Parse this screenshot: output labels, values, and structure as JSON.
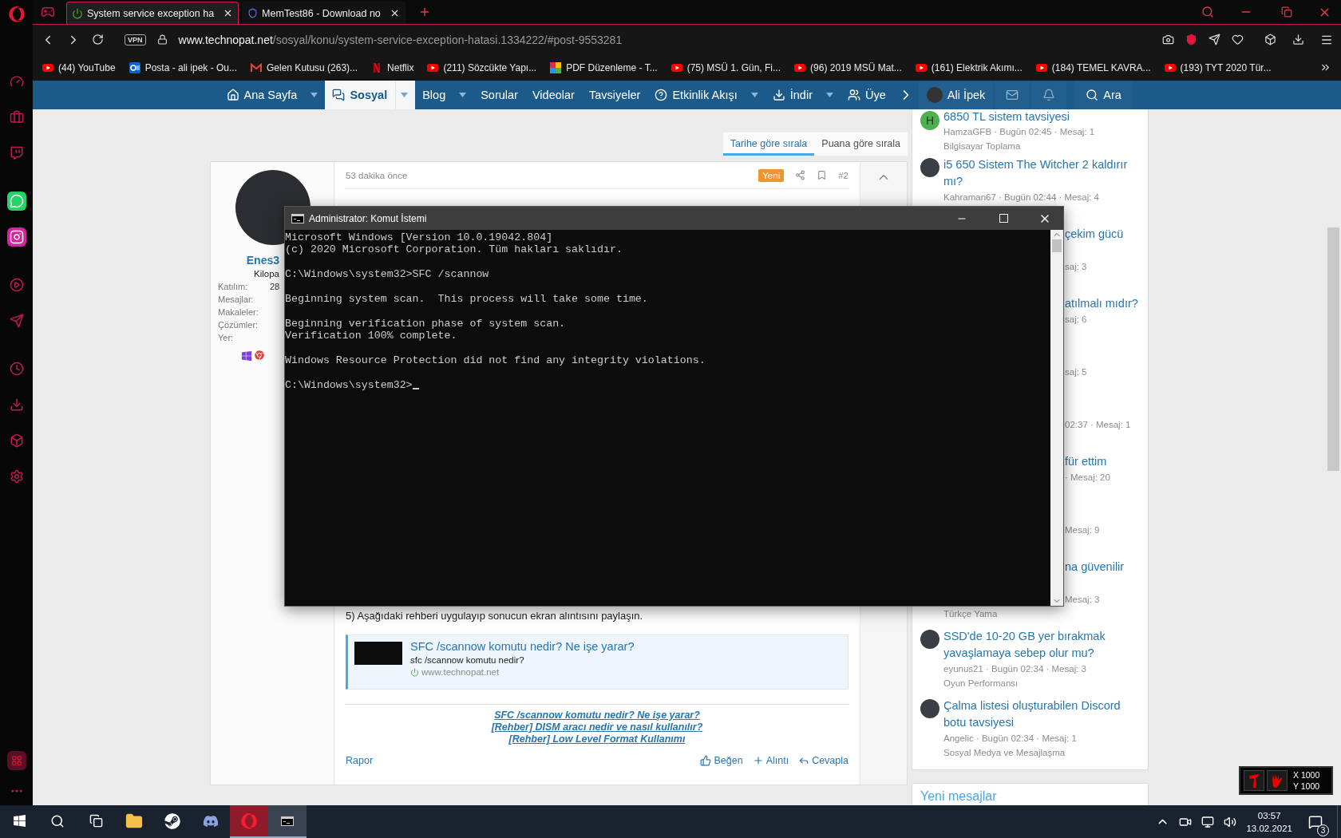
{
  "browser": {
    "tabs": [
      {
        "title": "System service exception ha",
        "selected": true
      },
      {
        "title": "MemTest86 - Download no",
        "selected": false
      }
    ],
    "address": {
      "vpn": "VPN",
      "domain": "www.technopat.net",
      "path": "/sosyal/konu/system-service-exception-hatasi.1334222/#post-9553281"
    },
    "bookmarks": [
      {
        "kind": "youtube",
        "label": "(44) YouTube"
      },
      {
        "kind": "outlook",
        "label": "Posta - ali ipek - Ou..."
      },
      {
        "kind": "gmail",
        "label": "Gelen Kutusu (263)..."
      },
      {
        "kind": "netflix",
        "label": "Netflix"
      },
      {
        "kind": "youtube",
        "label": "(211) Sözcükte Yapı..."
      },
      {
        "kind": "pdf",
        "label": "PDF Düzenleme - T..."
      },
      {
        "kind": "youtube",
        "label": "(75) MSÜ 1. Gün, Fi..."
      },
      {
        "kind": "youtube",
        "label": "(96) 2019 MSÜ Mat..."
      },
      {
        "kind": "youtube",
        "label": "(161) Elektrik Akımı..."
      },
      {
        "kind": "youtube",
        "label": "(184) TEMEL KAVRA..."
      },
      {
        "kind": "youtube",
        "label": "(193) TYT 2020 Tür..."
      }
    ]
  },
  "site_nav": {
    "items": [
      {
        "kind": "home",
        "label": "Ana Sayfa",
        "dropdown": true,
        "selected": false
      },
      {
        "kind": "social",
        "label": "Sosyal",
        "dropdown": true,
        "selected": true
      },
      {
        "kind": "plain",
        "label": "Blog",
        "dropdown": true,
        "selected": false
      },
      {
        "kind": "plain",
        "label": "Sorular",
        "dropdown": false,
        "selected": false
      },
      {
        "kind": "plain",
        "label": "Videolar",
        "dropdown": false,
        "selected": false
      },
      {
        "kind": "plain",
        "label": "Tavsiyeler",
        "dropdown": false,
        "selected": false
      },
      {
        "kind": "activity",
        "label": "Etkinlik Akışı",
        "dropdown": true,
        "selected": false
      },
      {
        "kind": "downloads",
        "label": "İndir",
        "dropdown": true,
        "selected": false
      },
      {
        "kind": "members",
        "label": "Üye",
        "dropdown": false,
        "selected": false
      }
    ],
    "user": "Ali İpek",
    "search": "Ara"
  },
  "sort_tabs": [
    {
      "label": "Tarihe göre sırala",
      "selected": true
    },
    {
      "label": "Puana göre sırala",
      "selected": false
    }
  ],
  "post": {
    "user": {
      "name": "Enes3",
      "title": "Kilopa",
      "stats": [
        {
          "label": "Katılım:",
          "value": "28"
        },
        {
          "label": "Mesajlar:"
        },
        {
          "label": "Makaleler:"
        },
        {
          "label": "Çözümler:"
        },
        {
          "label": "Yer:"
        }
      ]
    },
    "time": "53 dakika önce",
    "badge": "Yeni",
    "number": "#2",
    "step": "5) Aşağıdaki rehberi uygulayıp sonucun ekran alıntısını paylaşın.",
    "preview": {
      "title": "SFC /scannow komutu nedir? Ne işe yarar?",
      "snippet": "sfc /scannow komutu nedir?",
      "site": "www.technopat.net"
    },
    "links": [
      "SFC /scannow komutu nedir? Ne işe yarar?",
      "[Rehber] DISM aracı nedir ve nasıl kullanılır?",
      "[Rehber] Low Level Format Kullanımı"
    ],
    "report": "Rapor",
    "actions": [
      {
        "kind": "like",
        "label": "Beğen"
      },
      {
        "kind": "quote",
        "label": "Alıntı"
      },
      {
        "kind": "reply",
        "label": "Cevapla"
      }
    ]
  },
  "sidebar": {
    "items": [
      {
        "kind": "full",
        "avatar_letter": "H",
        "lines": [
          {
            "kind": "title",
            "text": "6850 TL sistem tavsiyesi"
          },
          {
            "kind": "meta",
            "text": "HamzaGFB · Bugün 02:45 · Mesaj: 1"
          },
          {
            "kind": "category",
            "text": "Bilgisayar Toplama"
          }
        ]
      },
      {
        "kind": "full",
        "lines": [
          {
            "kind": "title",
            "text": "i5 650 Sistem The Witcher 2 kaldırır mı?"
          },
          {
            "kind": "meta",
            "text": "Kahraman67 · Bugün 02:44 · Mesaj: 4"
          },
          {
            "kind": "covered_meta"
          }
        ]
      },
      {
        "kind": "covered",
        "lines": [
          {
            "kind": "title_fragment",
            "text": "çekim gücü"
          },
          {
            "kind": "covered_title"
          },
          {
            "kind": "meta_fragment",
            "text": "saj: 3"
          },
          {
            "kind": "covered_meta"
          }
        ]
      },
      {
        "kind": "covered",
        "lines": [
          {
            "kind": "title_fragment",
            "text": "atılmalı mıdır?"
          },
          {
            "kind": "meta_fragment",
            "text": "saj: 6"
          },
          {
            "kind": "covered_meta"
          }
        ]
      },
      {
        "kind": "covered",
        "lines": [
          {
            "kind": "covered_title"
          },
          {
            "kind": "meta_fragment",
            "text": "saj: 5"
          },
          {
            "kind": "covered_meta"
          }
        ]
      },
      {
        "kind": "covered",
        "lines": [
          {
            "kind": "covered_title"
          },
          {
            "kind": "meta_fragment",
            "text": "02:37 · Mesaj: 1"
          },
          {
            "kind": "covered_meta"
          }
        ]
      },
      {
        "kind": "covered",
        "lines": [
          {
            "kind": "title_fragment",
            "text": "für ettim"
          },
          {
            "kind": "meta_fragment",
            "text": "· Mesaj: 20"
          },
          {
            "kind": "covered_meta"
          }
        ]
      },
      {
        "kind": "covered",
        "lines": [
          {
            "kind": "covered_title"
          },
          {
            "kind": "meta_fragment",
            "text": "Mesaj: 9"
          },
          {
            "kind": "covered_meta"
          }
        ]
      },
      {
        "kind": "covered",
        "lines": [
          {
            "kind": "title_fragment",
            "text": "na güvenilir"
          },
          {
            "kind": "covered_title"
          },
          {
            "kind": "meta_fragment",
            "text": "Mesaj: 3"
          },
          {
            "kind": "category",
            "text": "Türkçe Yama"
          }
        ]
      },
      {
        "kind": "full",
        "lines": [
          {
            "kind": "title",
            "text": "SSD'de 10-20 GB yer bırakmak yavaşlamaya sebep olur mu?"
          },
          {
            "kind": "meta",
            "text": "eyunus21 · Bugün 02:34 · Mesaj: 3"
          },
          {
            "kind": "category",
            "text": "Oyun Performansı"
          }
        ]
      },
      {
        "kind": "full",
        "lines": [
          {
            "kind": "title",
            "text": "Çalma listesi oluşturabilen Discord botu tavsiyesi"
          },
          {
            "kind": "meta",
            "text": "Angelic · Bugün 02:34 · Mesaj: 1"
          },
          {
            "kind": "category",
            "text": "Sosyal Medya ve Mesajlaşma"
          }
        ]
      }
    ],
    "next_title": "Yeni mesajlar"
  },
  "console": {
    "title": "Administrator: Komut İstemi",
    "blocks": [
      [
        "Microsoft Windows [Version 10.0.19042.804]",
        "(c) 2020 Microsoft Corporation. Tüm hakları saklıdır."
      ],
      [
        "C:\\Windows\\system32>SFC /scannow"
      ],
      [
        "Beginning system scan.  This process will take some time."
      ],
      [
        "Beginning verification phase of system scan.",
        "Verification 100% complete."
      ],
      [
        "Windows Resource Protection did not find any integrity violations."
      ],
      [
        "C:\\Windows\\system32>"
      ]
    ],
    "cursor": true
  },
  "overlay": {
    "x": "X 1000",
    "y": "Y 1000"
  },
  "taskbar": {
    "apps": [
      {
        "kind": "explorer",
        "active": false
      },
      {
        "kind": "steam",
        "active": false
      },
      {
        "kind": "discord",
        "active": false
      },
      {
        "kind": "opera",
        "active": true
      },
      {
        "kind": "console",
        "active": true
      }
    ],
    "time": "03:57",
    "date": "13.02.2021",
    "notifications": "3"
  }
}
